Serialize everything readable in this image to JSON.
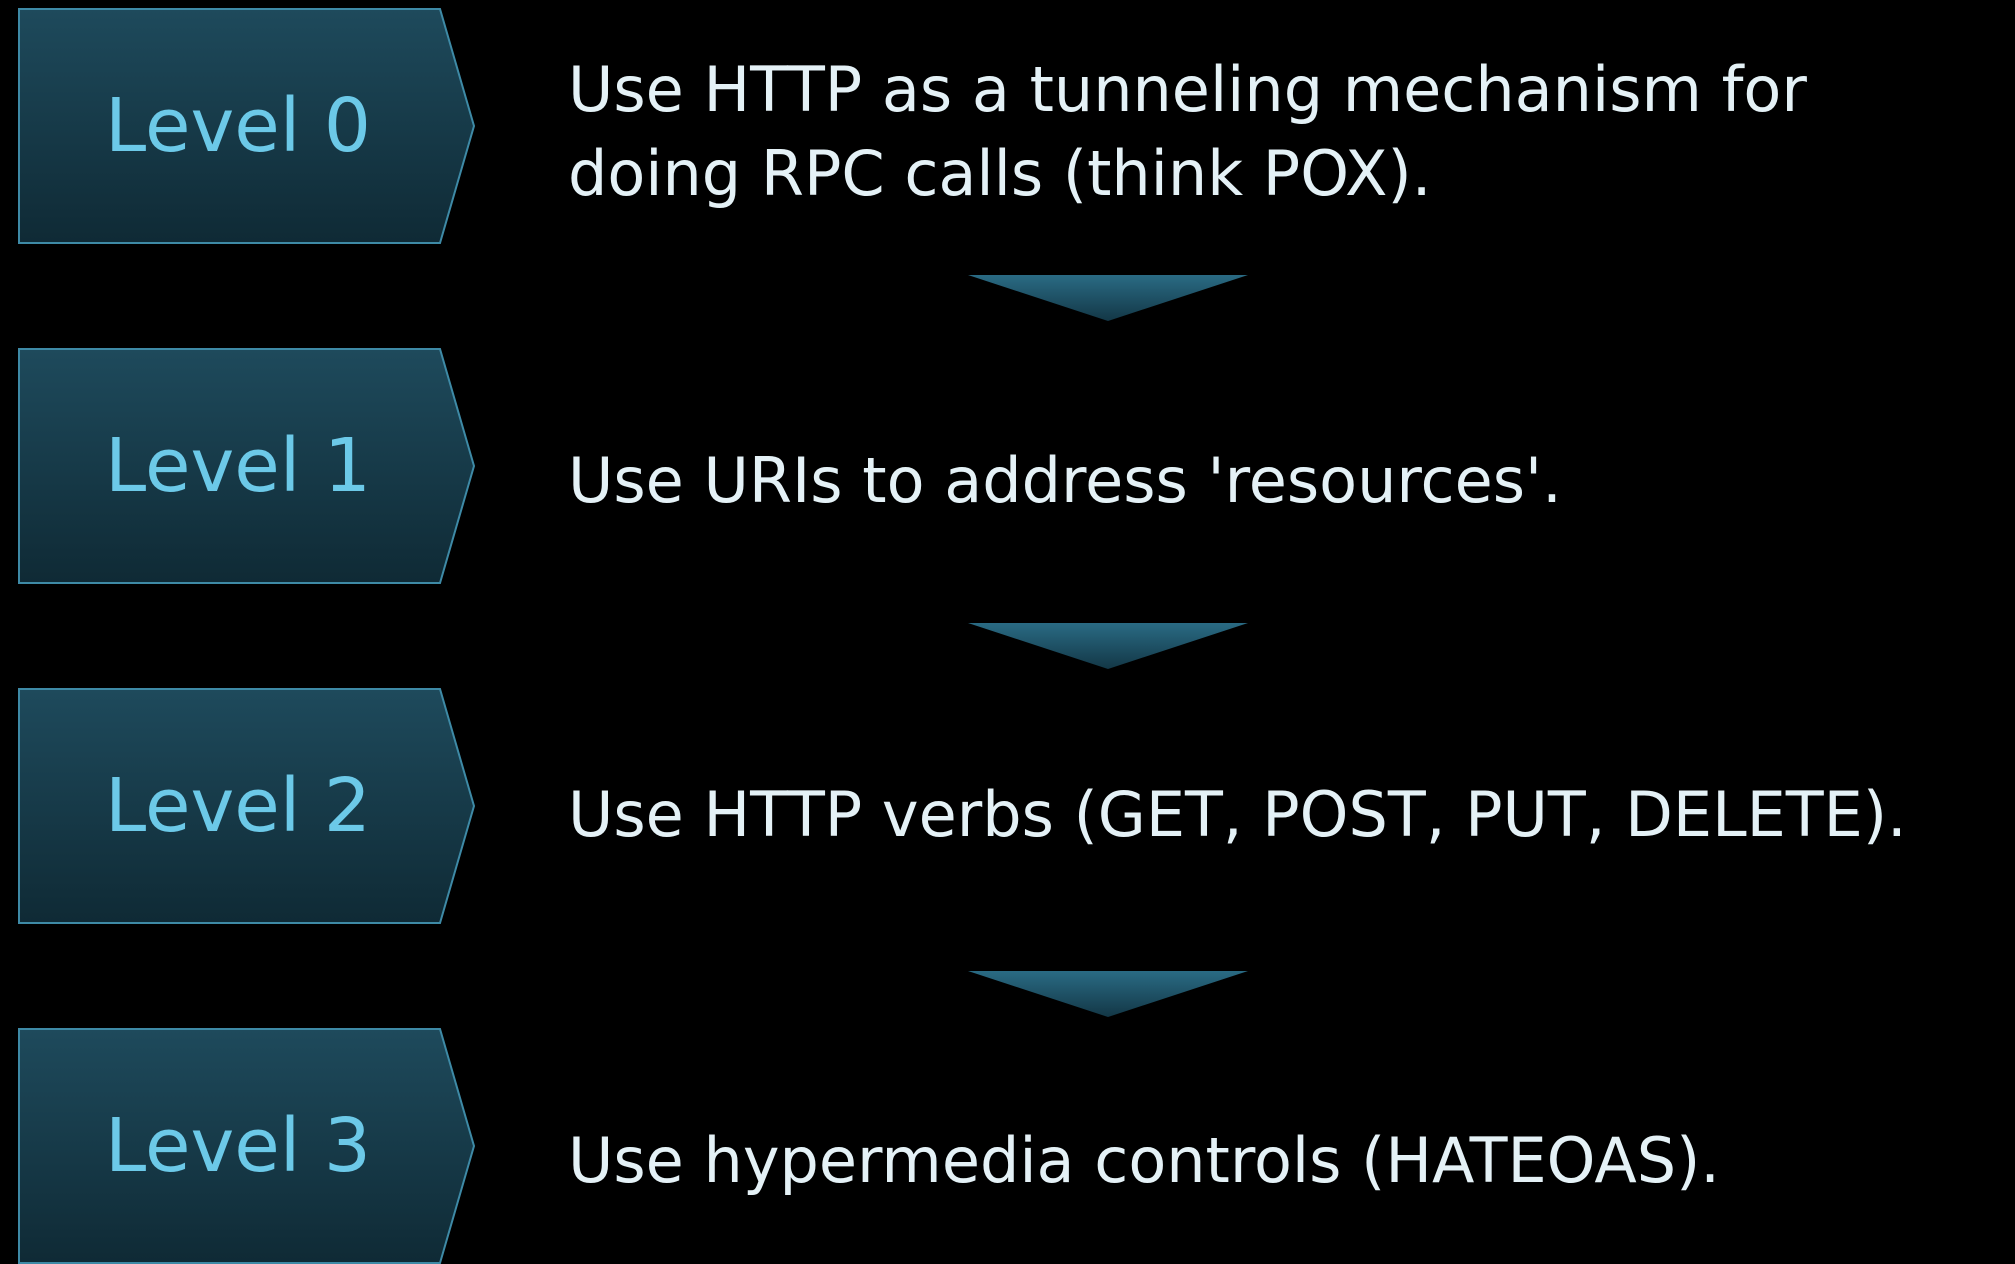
{
  "levels": [
    {
      "label": "Level 0",
      "description": "Use HTTP as a tunneling mechanism for doing RPC calls (think POX)."
    },
    {
      "label": "Level 1",
      "description": "Use URIs to address 'resources'."
    },
    {
      "label": "Level 2",
      "description": "Use HTTP verbs (GET, POST, PUT, DELETE)."
    },
    {
      "label": "Level 3",
      "description": "Use hypermedia controls (HATEOAS)."
    }
  ],
  "colors": {
    "background": "#000000",
    "box_fill_top": "#1e4a5c",
    "box_fill_bottom": "#112c38",
    "box_border": "#3e8aa6",
    "label_text": "#6cc9e8",
    "description_text": "#e4f1f6",
    "arrow_fill": "#235a70"
  }
}
